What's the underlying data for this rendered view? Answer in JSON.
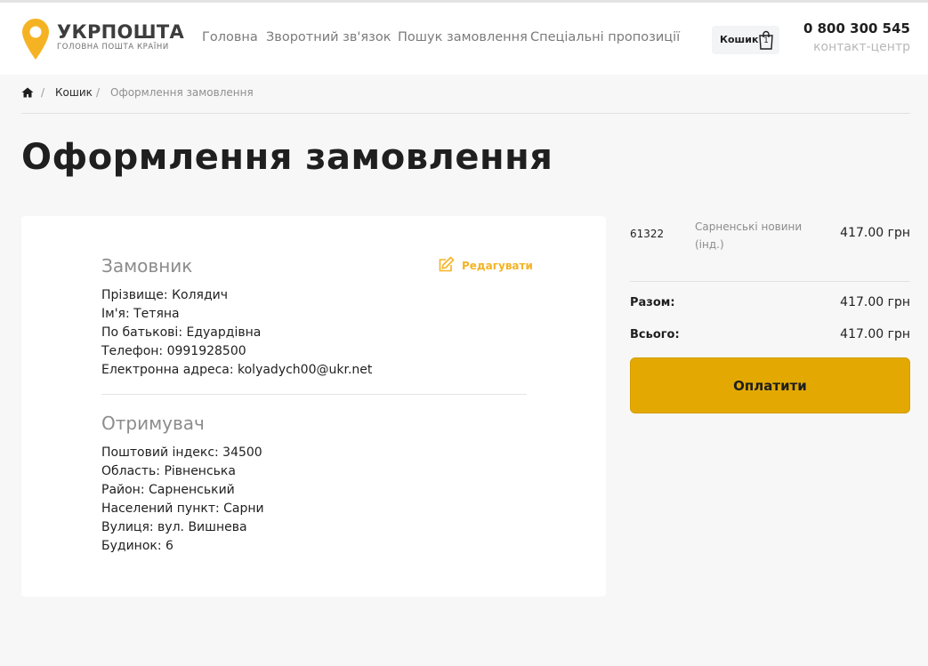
{
  "header": {
    "brand": "УКРПОШТА",
    "tagline": "ГОЛОВНА ПОШТА КРАЇНИ",
    "nav": [
      "Головна",
      "Зворотний зв'язок",
      "Пошук замовлення",
      "Спеціальні пропозиції"
    ],
    "cart_label": "Кошик",
    "cart_count": "1",
    "phone": "0 800 300 545",
    "phone_sub": "контакт-центр",
    "colors": {
      "brand_yellow": "#f5b324",
      "pay_button": "#e3a902"
    }
  },
  "breadcrumb": {
    "home_icon": "home-icon",
    "cart": "Кошик",
    "current": "Оформлення замовлення",
    "separator": "/"
  },
  "page_title": "Оформлення замовлення",
  "customer": {
    "title": "Замовник",
    "edit_label": "Редагувати",
    "lines": [
      "Прізвище: Колядич",
      "Ім'я: Тетяна",
      "По батькові: Едуардівна",
      "Телефон: 0991928500",
      "Електронна адреса: kolyadych00@ukr.net"
    ]
  },
  "recipient": {
    "title": "Отримувач",
    "lines": [
      "Поштовий індекс: 34500",
      "Область: Рівненська",
      "Район: Сарненський",
      "Населений пункт: Сарни",
      "Вулиця: вул. Вишнева",
      "Будинок: 6"
    ]
  },
  "summary": {
    "item": {
      "id": "61322",
      "name": "Сарненські новини (інд.)",
      "price": "417.00 грн"
    },
    "subtotal_label": "Разом:",
    "subtotal": "417.00 грн",
    "total_label": "Всього:",
    "total": "417.00 грн",
    "pay_label": "Оплатити"
  }
}
